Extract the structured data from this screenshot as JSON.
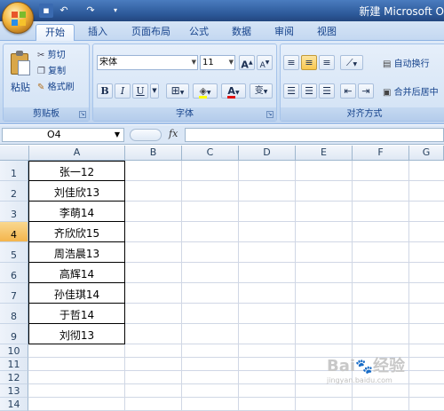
{
  "window_title": "新建 Microsoft O",
  "qat": {
    "undo": "↶",
    "redo": "↷"
  },
  "tabs": [
    "开始",
    "插入",
    "页面布局",
    "公式",
    "数据",
    "审阅",
    "视图"
  ],
  "clipboard": {
    "paste": "粘贴",
    "cut": "剪切",
    "copy": "复制",
    "format_painter": "格式刷",
    "group_label": "剪贴板"
  },
  "font": {
    "name": "宋体",
    "size": "11",
    "grow": "A",
    "shrink": "A",
    "bold": "B",
    "italic": "I",
    "underline": "U",
    "color_letter": "A",
    "phonetic": "变",
    "group_label": "字体"
  },
  "alignment": {
    "wrap_text": "自动换行",
    "merge_center": "合并后居中",
    "group_label": "对齐方式"
  },
  "formula_bar": {
    "name_box": "O4",
    "fx": "fx",
    "content": ""
  },
  "columns": [
    "A",
    "B",
    "C",
    "D",
    "E",
    "F",
    "G"
  ],
  "rows": [
    "1",
    "2",
    "3",
    "4",
    "5",
    "6",
    "7",
    "8",
    "9",
    "10",
    "11",
    "12",
    "13",
    "14"
  ],
  "selected_row": "4",
  "cells_A": [
    "张一12",
    "刘佳欣13",
    "李萌14",
    "齐欣欣15",
    "周浩晨13",
    "高辉14",
    "孙佳琪14",
    "于哲14",
    "刘彻13"
  ],
  "colors": {
    "accent": "#2b5797",
    "ribbon": "#c9dcf2",
    "selected_row": "#f4b54c"
  }
}
